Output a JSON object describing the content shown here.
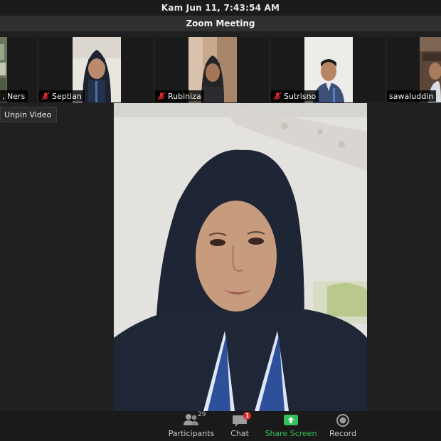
{
  "system_bar": {
    "clock": "Kam Jun 11,  7:43:54 AM"
  },
  "window": {
    "title": "Zoom Meeting"
  },
  "participants_strip": [
    {
      "name": ", Ners",
      "muted": false
    },
    {
      "name": "Septian",
      "muted": true
    },
    {
      "name": "Rubiniza",
      "muted": true
    },
    {
      "name": "Sutrisno",
      "muted": true
    },
    {
      "name": "sawaluddin",
      "muted": false
    }
  ],
  "unpin_label": "Unpin Video",
  "toolbar": {
    "participants": {
      "label": "Participants",
      "count": "29",
      "icon": "participants-icon"
    },
    "chat": {
      "label": "Chat",
      "badge": "1",
      "icon": "chat-icon"
    },
    "share": {
      "label": "Share Screen",
      "icon": "share-screen-icon"
    },
    "record": {
      "label": "Record",
      "icon": "record-icon"
    }
  },
  "colors": {
    "share_green": "#33c05a",
    "badge_red": "#e02828",
    "mute_red": "#e02828"
  }
}
